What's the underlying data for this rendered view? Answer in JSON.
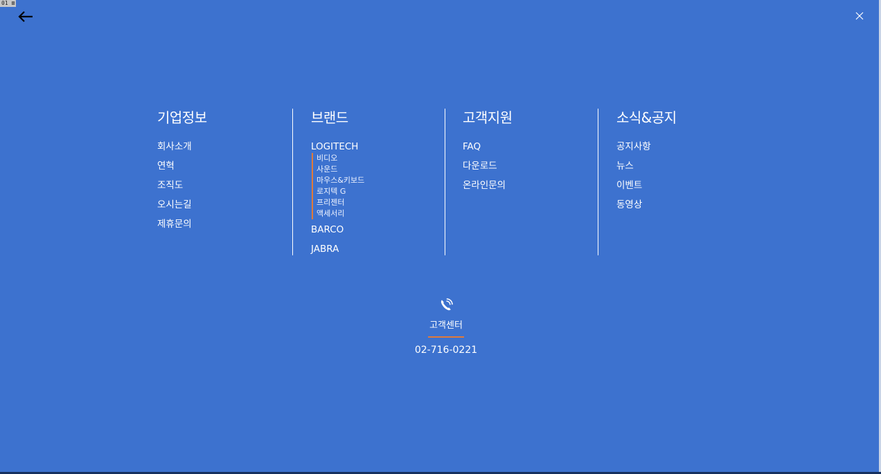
{
  "window": {
    "badge": "01 ⊠"
  },
  "nav": {
    "back_icon": "arrow-left-icon",
    "close_icon": "close-icon"
  },
  "menu": {
    "company": {
      "title": "기업정보",
      "links": [
        "회사소개",
        "연혁",
        "조직도",
        "오시는길",
        "제휴문의"
      ]
    },
    "brand": {
      "title": "브랜드",
      "logitech": "LOGITECH",
      "logitech_sub": [
        "비디오",
        "사운드",
        "마우스&키보드",
        "로지텍 G",
        "프리젠터",
        "액세서리"
      ],
      "barco": "BARCO",
      "jabra": "JABRA"
    },
    "support": {
      "title": "고객지원",
      "links": [
        "FAQ",
        "다운로드",
        "온라인문의"
      ]
    },
    "news": {
      "title": "소식&공지",
      "links": [
        "공지사항",
        "뉴스",
        "이벤트",
        "동영상"
      ]
    }
  },
  "customer_center": {
    "icon": "phone-icon",
    "label": "고객센터",
    "phone": "02-716-0221"
  },
  "colors": {
    "background": "#3d72cf",
    "accent": "#e07a3a",
    "text": "#ffffff"
  }
}
